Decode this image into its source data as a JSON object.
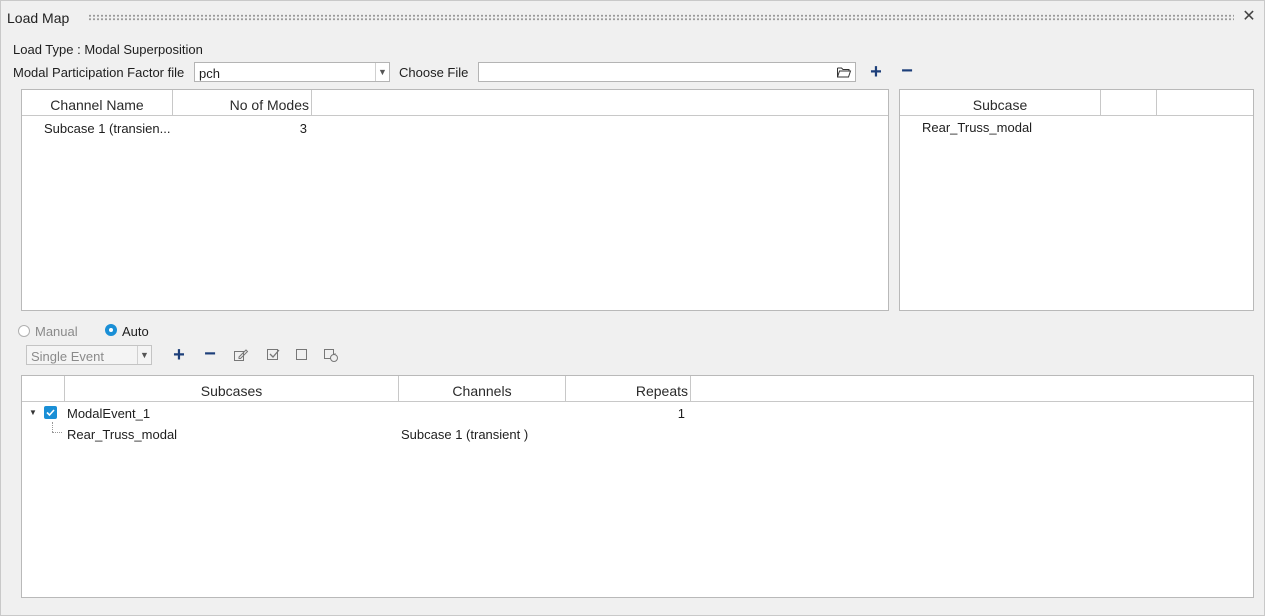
{
  "window": {
    "title": "Load Map"
  },
  "load_type": "Load Type : Modal Superposition",
  "mpf_file": {
    "label": "Modal Participation Factor file",
    "selected": "pch"
  },
  "choose_file": {
    "label": "Choose File",
    "value": ""
  },
  "channels_table": {
    "columns": [
      "Channel Name",
      "No of Modes"
    ],
    "rows": [
      {
        "name": "Subcase 1 (transien...",
        "modes": "3"
      }
    ]
  },
  "subcase_table": {
    "columns": [
      "Subcase"
    ],
    "rows": [
      "Rear_Truss_modal"
    ]
  },
  "mode": {
    "manual_label": "Manual",
    "auto_label": "Auto",
    "selected": "Auto"
  },
  "event_type": {
    "selected": "Single Event"
  },
  "events_table": {
    "columns": [
      "Subcases",
      "Channels",
      "Repeats"
    ],
    "rows": [
      {
        "name": "ModalEvent_1",
        "channels": "",
        "repeats": "1",
        "checked": true
      },
      {
        "name": "Rear_Truss_modal",
        "channels": "Subcase 1 (transient )",
        "repeats": ""
      }
    ]
  },
  "colors": {
    "accent": "#1a8fd6",
    "toolbar_icon": "#1d3f7a"
  }
}
